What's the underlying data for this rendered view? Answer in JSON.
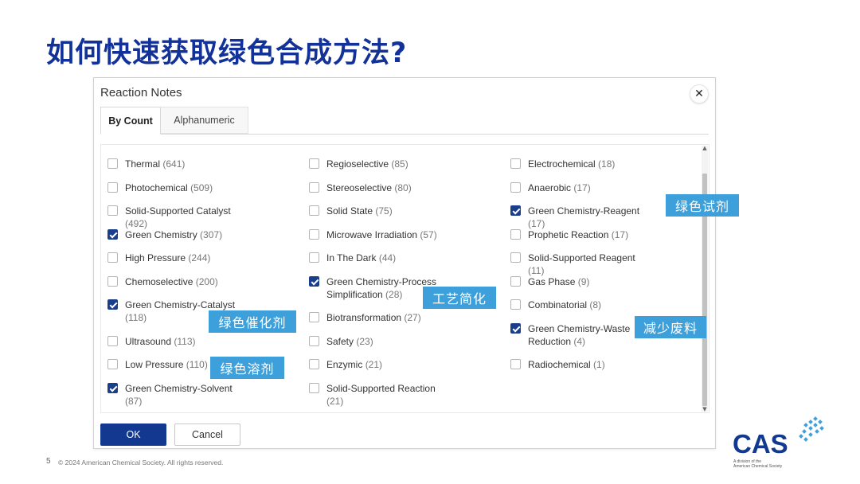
{
  "slide": {
    "title": "如何快速获取绿色合成方法?",
    "page_number": "5",
    "copyright": "© 2024 American Chemical Society. All rights reserved."
  },
  "dialog": {
    "title": "Reaction Notes",
    "close_icon": "close-icon",
    "tabs": [
      {
        "label": "By Count",
        "active": true
      },
      {
        "label": "Alphanumeric",
        "active": false
      }
    ],
    "columns": [
      [
        {
          "label": "Thermal",
          "count": "(641)",
          "checked": false
        },
        {
          "label": "Photochemical",
          "count": "(509)",
          "checked": false
        },
        {
          "label": "Solid-Supported Catalyst",
          "count": "(492)",
          "checked": false
        },
        {
          "label": "Green Chemistry",
          "count": "(307)",
          "checked": true
        },
        {
          "label": "High Pressure",
          "count": "(244)",
          "checked": false
        },
        {
          "label": "Chemoselective",
          "count": "(200)",
          "checked": false
        },
        {
          "label": "Green Chemistry-Catalyst",
          "count": "(118)",
          "checked": true
        },
        {
          "label": "Ultrasound",
          "count": "(113)",
          "checked": false
        },
        {
          "label": "Low Pressure",
          "count": "(110)",
          "checked": false
        },
        {
          "label": "Green Chemistry-Solvent",
          "count": "(87)",
          "checked": true
        }
      ],
      [
        {
          "label": "Regioselective",
          "count": "(85)",
          "checked": false
        },
        {
          "label": "Stereoselective",
          "count": "(80)",
          "checked": false
        },
        {
          "label": "Solid State",
          "count": "(75)",
          "checked": false
        },
        {
          "label": "Microwave Irradiation",
          "count": "(57)",
          "checked": false
        },
        {
          "label": "In The Dark",
          "count": "(44)",
          "checked": false
        },
        {
          "label": "Green Chemistry-Process Simplification",
          "count": "(28)",
          "checked": true
        },
        {
          "label": "Biotransformation",
          "count": "(27)",
          "checked": false
        },
        {
          "label": "Safety",
          "count": "(23)",
          "checked": false
        },
        {
          "label": "Enzymic",
          "count": "(21)",
          "checked": false
        },
        {
          "label": "Solid-Supported Reaction",
          "count": "(21)",
          "checked": false
        }
      ],
      [
        {
          "label": "Electrochemical",
          "count": "(18)",
          "checked": false
        },
        {
          "label": "Anaerobic",
          "count": "(17)",
          "checked": false
        },
        {
          "label": "Green Chemistry-Reagent",
          "count": "(17)",
          "checked": true
        },
        {
          "label": "Prophetic Reaction",
          "count": "(17)",
          "checked": false
        },
        {
          "label": "Solid-Supported Reagent",
          "count": "(11)",
          "checked": false
        },
        {
          "label": "Gas Phase",
          "count": "(9)",
          "checked": false
        },
        {
          "label": "Combinatorial",
          "count": "(8)",
          "checked": false
        },
        {
          "label": "Green Chemistry-Waste Reduction",
          "count": "(4)",
          "checked": true
        },
        {
          "label": "Radiochemical",
          "count": "(1)",
          "checked": false
        }
      ]
    ],
    "ok_label": "OK",
    "cancel_label": "Cancel"
  },
  "callouts": {
    "reagent": "绿色试剂",
    "process": "工艺简化",
    "catalyst": "绿色催化剂",
    "waste": "减少废料",
    "solvent": "绿色溶剂"
  },
  "logo": {
    "text": "CAS",
    "sub1": "A division of the",
    "sub2": "American Chemical Society",
    "accent_color": "#12398f",
    "mark_color": "#3ea0db"
  },
  "colors": {
    "title": "#12329a",
    "checkbox_checked": "#1a3e8c",
    "ok_button": "#12398f",
    "callout": "#3ea0db"
  }
}
